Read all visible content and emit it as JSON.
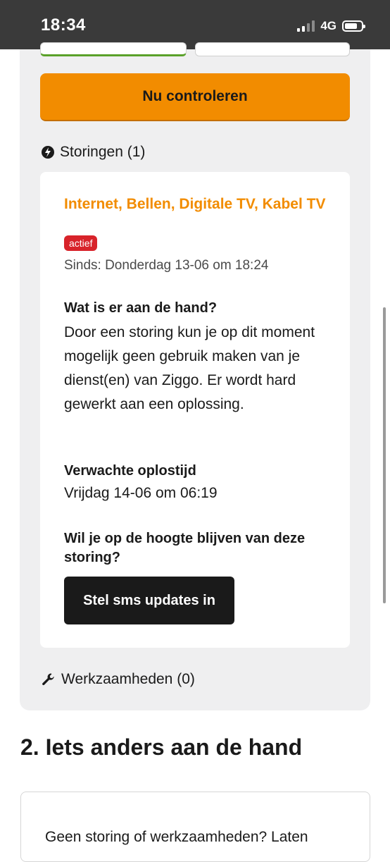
{
  "status_bar": {
    "time": "18:34",
    "network": "4G"
  },
  "check": {
    "button_label": "Nu controleren"
  },
  "storingen": {
    "heading": "Storingen (1)",
    "outage": {
      "title": "Internet, Bellen, Digitale TV, Kabel TV",
      "badge": "actief",
      "since": "Sinds: Donderdag 13-06 om 18:24",
      "question": "Wat is er aan de hand?",
      "description": "Door een storing kun je op dit moment mogelijk geen gebruik maken van je dienst(en) van Ziggo. Er wordt hard gewerkt aan een oplossing.",
      "eta_label": "Verwachte oplostijd",
      "eta_value": "Vrijdag 14-06 om 06:19",
      "updates_question": "Wil je op de hoogte blijven van deze storing?",
      "sms_button": "Stel sms updates in"
    }
  },
  "werkzaamheden": {
    "heading": "Werkzaamheden (0)"
  },
  "section2": {
    "heading": "2. Iets anders aan de hand",
    "card_text": "Geen storing of werkzaamheden? Laten"
  },
  "colors": {
    "accent": "#f28c00",
    "badge": "#d8232a",
    "dark_button": "#1a1a1a",
    "panel_bg": "#efeff0"
  }
}
